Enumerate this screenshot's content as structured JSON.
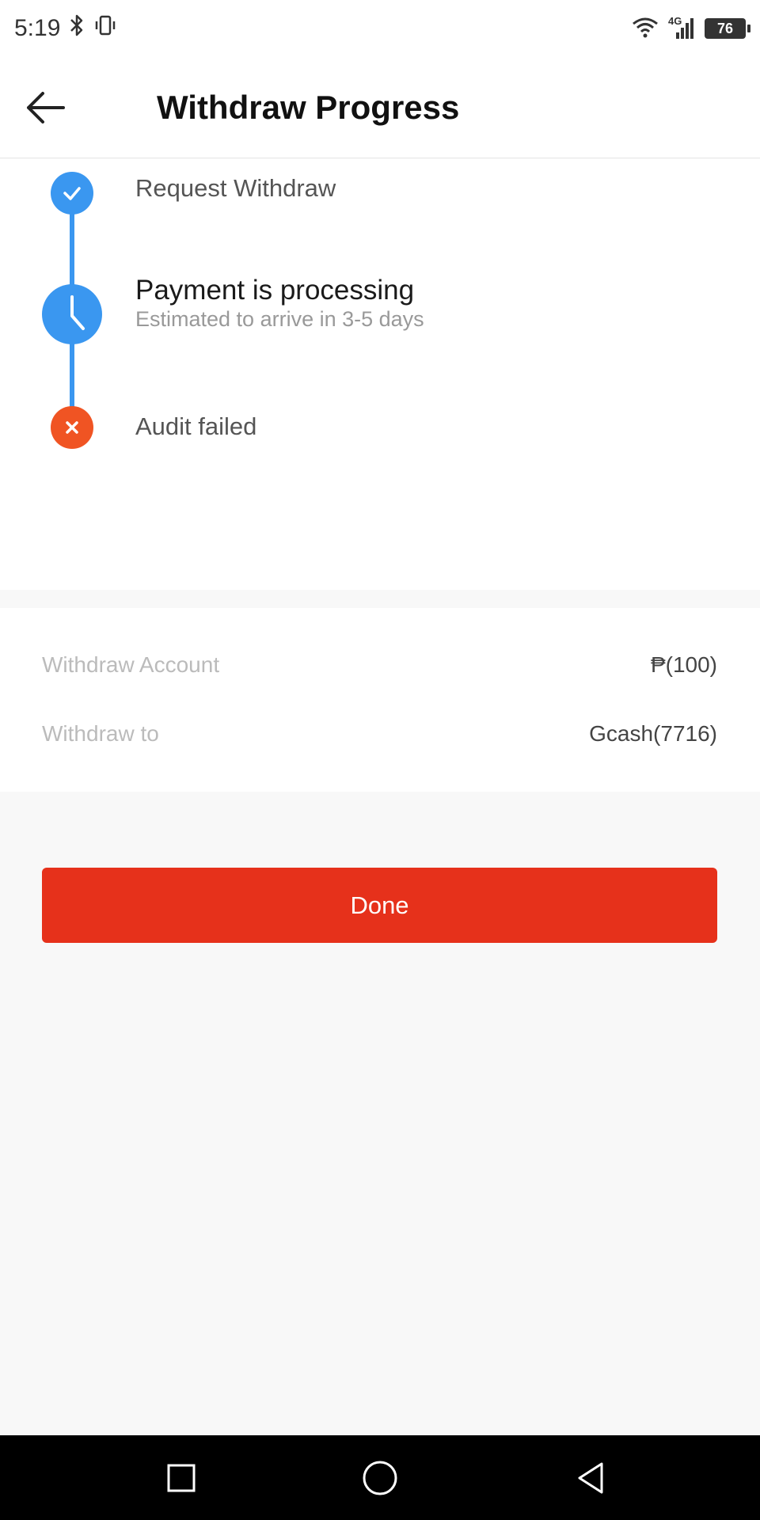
{
  "status_bar": {
    "time": "5:19",
    "network": "4G",
    "battery": "76",
    "icons": [
      "bluetooth-icon",
      "vibrate-icon",
      "wifi-icon",
      "signal-icon",
      "battery-icon"
    ]
  },
  "header": {
    "title": "Withdraw Progress",
    "back_icon": "arrow-left-icon"
  },
  "steps": [
    {
      "title": "Request Withdraw",
      "status": "done",
      "icon": "check-icon",
      "color": "#3a97f0"
    },
    {
      "title": "Payment is processing",
      "subtitle": "Estimated to arrive in 3-5 days",
      "status": "active",
      "icon": "clock-icon",
      "color": "#3a97f0"
    },
    {
      "title": "Audit failed",
      "status": "failed",
      "icon": "close-icon",
      "color": "#f05423"
    }
  ],
  "details": {
    "account_label": "Withdraw Account",
    "account_value": "₱(100)",
    "to_label": "Withdraw to",
    "to_value": "Gcash(7716)"
  },
  "done_button": {
    "label": "Done",
    "color": "#e6311b"
  },
  "nav_bar": {
    "icons": [
      "recents-icon",
      "home-icon",
      "back-triangle-icon"
    ]
  }
}
